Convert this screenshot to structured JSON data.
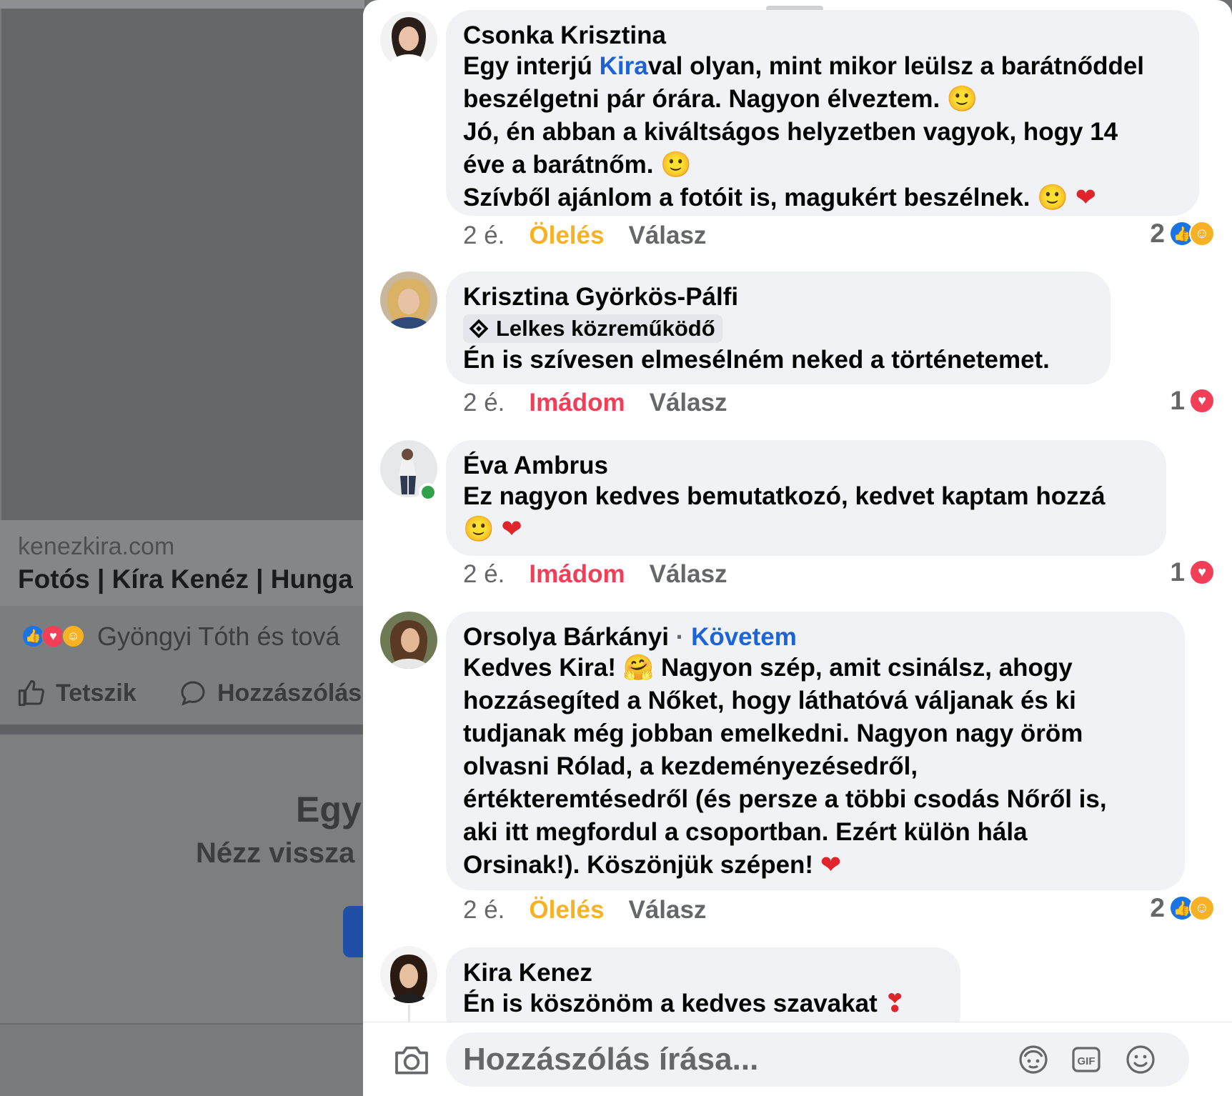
{
  "background_post": {
    "domain": "kenezkira.com",
    "title": "Fotós | Kíra Kenéz | Hunga",
    "reactions_text": "Gyöngyi Tóth és tová",
    "like_label": "Tetszik",
    "comment_label": "Hozzászólás",
    "promo_title": "Egy",
    "promo_sub": "Nézz vissza"
  },
  "comments": [
    {
      "author": "Csonka Krisztina",
      "text_before_mention": "Egy interjú ",
      "mention": "Kira",
      "line1_rest": "val olyan, mint mikor leülsz a barátnőddel",
      "line2": "beszélgetni pár órára. Nagyon élveztem.",
      "line3": "Jó, én abban a kiváltságos helyzetben vagyok, hogy 14",
      "line4": "éve a barátnőm.",
      "line5": "Szívből ajánlom a fotóit is, magukért beszélnek.",
      "time": "2 é.",
      "reaction_label": "Ölelés",
      "reply_label": "Válasz",
      "reaction_count": "2"
    },
    {
      "author": "Krisztina Györkös-Pálfi",
      "badge": "Lelkes közreműködő",
      "text": "Én is szívesen elmesélném neked a történetemet.",
      "time": "2 é.",
      "reaction_label": "Imádom",
      "reply_label": "Válasz",
      "reaction_count": "1"
    },
    {
      "author": "Éva Ambrus",
      "text": "Ez nagyon kedves bemutatkozó, kedvet kaptam hozzá",
      "time": "2 é.",
      "reaction_label": "Imádom",
      "reply_label": "Válasz",
      "reaction_count": "1"
    },
    {
      "author": "Orsolya Bárkányi",
      "follow": "Követem",
      "line1_a": "Kedves Kira!",
      "line1_b": "Nagyon szép, amit csinálsz, ahogy",
      "line2": "hozzásegíted a Nőket, hogy láthatóvá váljanak és ki",
      "line3": "tudjanak még jobban emelkedni. Nagyon nagy öröm",
      "line4": "olvasni Rólad, a kezdeményezésedről,",
      "line5": "értékteremtésedről (és persze a többi csodás Nőről is,",
      "line6": "aki itt megfordul a csoportban. Ezért külön hála",
      "line7": "Orsinak!). Köszönjük szépen!",
      "time": "2 é.",
      "reaction_label": "Ölelés",
      "reply_label": "Válasz",
      "reaction_count": "2"
    },
    {
      "author": "Kira Kenez",
      "text": "Én is köszönöm a kedves szavakat"
    }
  ],
  "composer": {
    "placeholder": "Hozzászólás írása..."
  }
}
